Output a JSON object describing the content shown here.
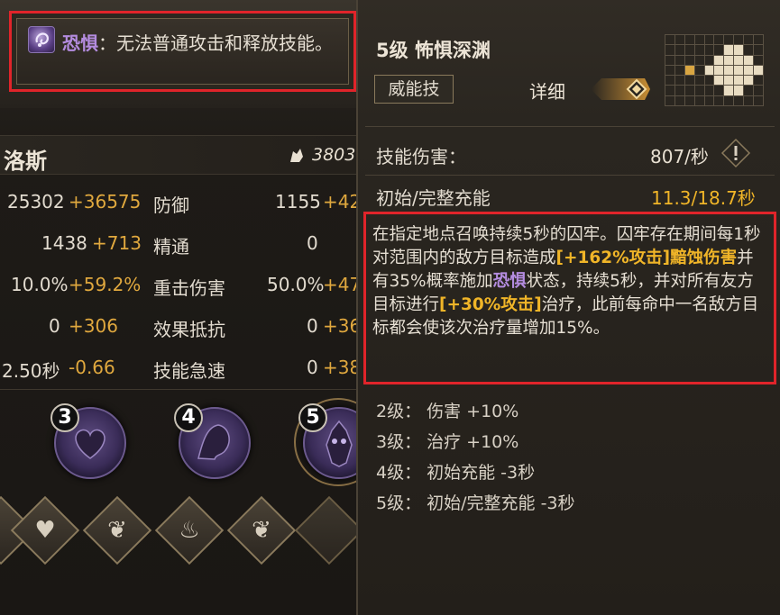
{
  "fear_tooltip": {
    "keyword": "恐惧",
    "text": "：无法普通攻击和释放技能。"
  },
  "character": {
    "name": "洛斯",
    "power": "3803"
  },
  "stats": [
    {
      "value": "25302",
      "bonus": "+36575",
      "label": "防御",
      "value2": "1155",
      "bonus2": "+42"
    },
    {
      "value": "1438",
      "bonus": "+713",
      "label": "精通",
      "value2": "0",
      "bonus2": ""
    },
    {
      "value": "10.0%",
      "bonus": "+59.2%",
      "label": "重击伤害",
      "value2": "50.0%",
      "bonus2": "+47"
    },
    {
      "value": "0",
      "bonus": "+306",
      "label": "效果抵抗",
      "value2": "0",
      "bonus2": "+36"
    },
    {
      "value": "2.50秒",
      "bonus": "-0.66",
      "label": "技能急速",
      "value2": "0",
      "bonus2": "+38"
    }
  ],
  "skill_orbs": [
    {
      "number": "3"
    },
    {
      "number": "4"
    },
    {
      "number": "5"
    }
  ],
  "skill": {
    "title": "5级  怖惧深渊",
    "tag": "威能技",
    "detail_label": "详细",
    "damage_label": "技能伤害：",
    "damage_value": "807/秒",
    "charge_label": "初始/完整充能",
    "charge_value": "11.3/18.7秒",
    "desc_p1": "在指定地点召唤持续5秒的囚牢。囚牢存在期间每1秒对范围内的敌方目标造成",
    "desc_gold1": "[+162%攻击]黯蚀伤害",
    "desc_p2": "并有35%概率施加",
    "desc_purple": "恐惧",
    "desc_p3": "状态，持续5秒，并对所有友方目标进行",
    "desc_gold2": "[+30%攻击]",
    "desc_p4": "治疗，此前每命中一名敌方目标都会使该次治疗量增加15%。",
    "levels": [
      "2级：  伤害 +10%",
      "3级：  治疗 +10%",
      "4级：  初始充能 -3秒",
      "5级：  初始/完整充能 -3秒"
    ]
  },
  "colors": {
    "highlight_border": "#e0242a",
    "gold": "#f0b528",
    "purple": "#b48cdf",
    "bonus": "#e0a83e"
  }
}
